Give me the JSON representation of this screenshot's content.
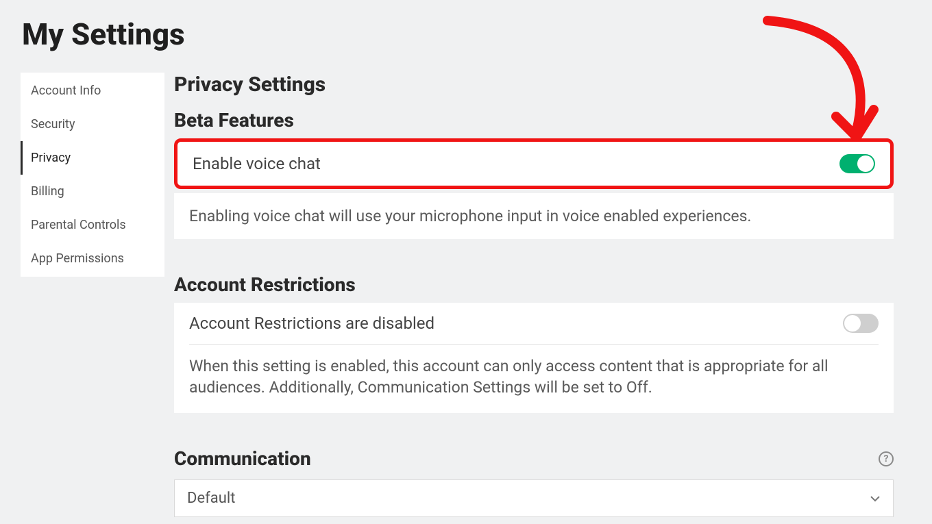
{
  "page": {
    "title": "My Settings"
  },
  "sidebar": {
    "items": [
      {
        "label": "Account Info",
        "active": false
      },
      {
        "label": "Security",
        "active": false
      },
      {
        "label": "Privacy",
        "active": true
      },
      {
        "label": "Billing",
        "active": false
      },
      {
        "label": "Parental Controls",
        "active": false
      },
      {
        "label": "App Permissions",
        "active": false
      }
    ]
  },
  "main": {
    "privacy_heading": "Privacy Settings",
    "beta": {
      "heading": "Beta Features",
      "voice_chat_label": "Enable voice chat",
      "voice_chat_enabled": true,
      "voice_chat_desc": "Enabling voice chat will use your microphone input in voice enabled experiences."
    },
    "restrictions": {
      "heading": "Account Restrictions",
      "status_label": "Account Restrictions are disabled",
      "enabled": false,
      "desc": "When this setting is enabled, this account can only access content that is appropriate for all audiences. Additionally, Communication Settings will be set to Off."
    },
    "communication": {
      "heading": "Communication",
      "help_glyph": "?",
      "selected": "Default"
    }
  },
  "colors": {
    "highlight": "#f01414",
    "toggle_on": "#00b06f",
    "toggle_off": "#cfcfcf"
  },
  "annotation": {
    "arrow_icon": "red-curved-arrow"
  }
}
